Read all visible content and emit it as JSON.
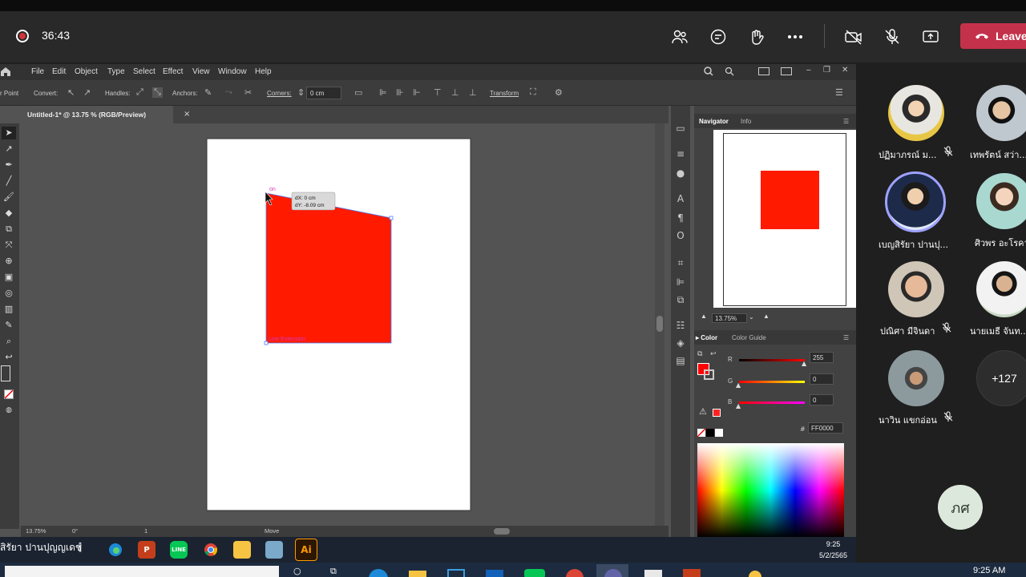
{
  "teams": {
    "timer": "36:43",
    "leave_label": "Leave"
  },
  "ai": {
    "menu": [
      "File",
      "Edit",
      "Object",
      "Type",
      "Select",
      "Effect",
      "View",
      "Window",
      "Help"
    ],
    "control": {
      "anchor_point": "r Point",
      "convert": "Convert:",
      "handles": "Handles:",
      "anchors": "Anchors:",
      "corners": "Corners:",
      "corner_value": "0 cm",
      "transform": "Transform"
    },
    "doc_tab": "Untitled-1* @ 13.75 % (RGB/Preview)",
    "doc_close": "×",
    "smart_guide_on": "on",
    "tooltip_dx": "dX: 0 cm",
    "tooltip_dy": "dY: -8.09 cm",
    "line_extension": "Line Extension",
    "shape_color": "#ff1a00",
    "status": {
      "zoom": "13.75%",
      "rotation": "0°",
      "artboard": "1",
      "tool": "Move"
    },
    "navigator": {
      "tab_navigator": "Navigator",
      "tab_info": "Info",
      "zoom": "13.75%"
    },
    "color": {
      "tab_color": "Color",
      "tab_guide": "Color Guide",
      "r_label": "R",
      "g_label": "G",
      "b_label": "B",
      "r_value": "255",
      "g_value": "0",
      "b_value": "0",
      "hex_prefix": "#",
      "hex": "FF0000"
    }
  },
  "inner_taskbar": {
    "presenter_name": "สิรัยา ปานปุญญเดช",
    "time": "9:25",
    "date": "5/2/2565",
    "ai_label": "Ai"
  },
  "participants": [
    {
      "name": "ปฏิมาภรณ์ ม...",
      "muted": true
    },
    {
      "name": "เทพรัตน์ สว่า...",
      "muted": false
    },
    {
      "name": "เบญสิรัยา ปานปุ...",
      "muted": false
    },
    {
      "name": "ศิวพร อะโรคา",
      "muted": false
    },
    {
      "name": "ปณิศา มีจินดา",
      "muted": true
    },
    {
      "name": "นายเมธี จันท...",
      "muted": false
    },
    {
      "name": "นาวิน แขกอ่อน",
      "muted": true
    }
  ],
  "more_count": "+127",
  "self_initials": "ภศ",
  "outer_time": "9:25 AM"
}
